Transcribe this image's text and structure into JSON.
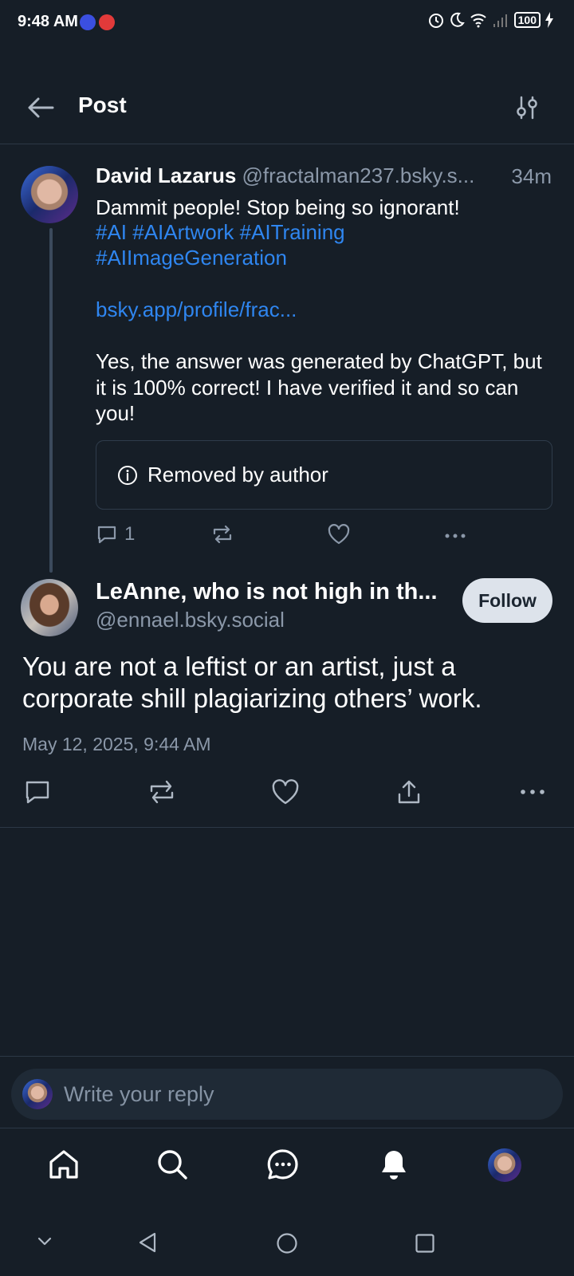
{
  "status_bar": {
    "time": "9:48 AM",
    "battery": "100"
  },
  "header": {
    "title": "Post"
  },
  "parent_post": {
    "author_name": "David Lazarus",
    "author_handle": "@fractalman237.bsky.s...",
    "time_ago": "34m",
    "text_line1": "Dammit people! Stop being so ignorant!",
    "hashtags_line1": "#AI #AIArtwork #AITraining",
    "hashtags_line2": "#AIImageGeneration",
    "link": "bsky.app/profile/frac...",
    "text_para2": "Yes, the answer was generated by ChatGPT, but it is 100% correct! I have verified it and so can you!",
    "embed_text": "Removed by author",
    "reply_count": "1"
  },
  "reply_post": {
    "author_name": "LeAnne, who is not high in th...",
    "author_handle": "@ennael.bsky.social",
    "follow_label": "Follow",
    "text": "You are not a leftist or an artist, just a corporate shill plagiarizing others’ work.",
    "date": "May 12, 2025, 9:44 AM"
  },
  "composer": {
    "placeholder": "Write your reply"
  },
  "icons": {
    "back": "arrow-left-icon",
    "filter": "sliders-icon",
    "reply": "comment-icon",
    "repost": "repost-icon",
    "like": "heart-icon",
    "share": "share-icon",
    "more": "ellipsis-icon",
    "info": "info-icon",
    "home": "home-icon",
    "search": "search-icon",
    "chat": "chat-icon",
    "notifications": "bell-icon"
  },
  "colors": {
    "background": "#161e27",
    "link": "#2f86f0",
    "muted": "#8b98a9",
    "follow_button": "#dde3eb"
  }
}
